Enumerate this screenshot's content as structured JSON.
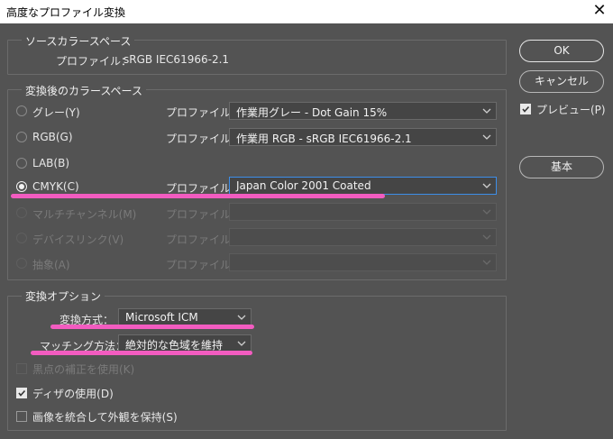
{
  "window": {
    "title": "高度なプロファイル変換",
    "close_glyph": "✕"
  },
  "source": {
    "legend": "ソースカラースペース",
    "profile_label": "プロファイル：",
    "profile_value": "sRGB IEC61966-2.1"
  },
  "dest": {
    "legend": "変換後のカラースペース",
    "profile_label": "プロファイル：",
    "rows": [
      {
        "label": "グレー(Y)",
        "value": "作業用グレー - Dot Gain 15%",
        "selected": false,
        "enabled": true
      },
      {
        "label": "RGB(G)",
        "value": "作業用 RGB - sRGB IEC61966-2.1",
        "selected": false,
        "enabled": true
      },
      {
        "label": "LAB(B)",
        "value": "",
        "selected": false,
        "enabled": true
      },
      {
        "label": "CMYK(C)",
        "value": "Japan Color 2001 Coated",
        "selected": true,
        "enabled": true
      },
      {
        "label": "マルチチャンネル(M)",
        "value": "",
        "selected": false,
        "enabled": false
      },
      {
        "label": "デバイスリンク(V)",
        "value": "",
        "selected": false,
        "enabled": false
      },
      {
        "label": "抽象(A)",
        "value": "",
        "selected": false,
        "enabled": false
      }
    ]
  },
  "options": {
    "legend": "変換オプション",
    "engine_label": "変換方式：",
    "engine_value": "Microsoft ICM",
    "intent_label": "マッチング方法：",
    "intent_value": "絶対的な色域を維持",
    "bpc_label": "黒点の補正を使用(K)",
    "bpc_checked": false,
    "dither_label": "ディザの使用(D)",
    "dither_checked": true,
    "flatten_label": "画像を統合して外観を保持(S)",
    "flatten_checked": false
  },
  "buttons": {
    "ok": "OK",
    "cancel": "キャンセル",
    "basic": "基本"
  },
  "preview": {
    "label": "プレビュー(P)",
    "checked": true
  },
  "colors": {
    "background": "#535353",
    "highlight": "#f25cc0",
    "focus": "#3d8ee8"
  },
  "icons": {
    "chevron": "chevron-down-icon",
    "check": "checkmark-icon",
    "close": "close-icon"
  }
}
